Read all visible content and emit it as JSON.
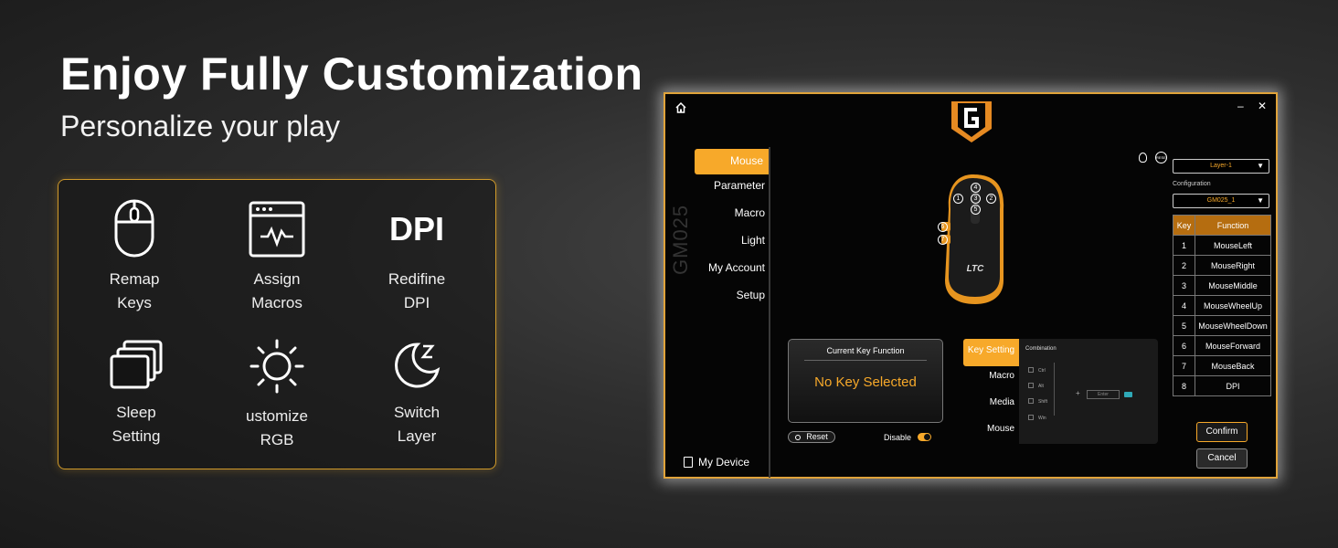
{
  "headline": "Enjoy Fully Customization",
  "subline": "Personalize your play",
  "features": [
    {
      "text": "Remap\nKeys",
      "icon": "mouse-icon"
    },
    {
      "text": "Assign\nMacros",
      "icon": "macro-window-icon"
    },
    {
      "text": "Redifine\nDPI",
      "icon": "dpi-icon",
      "icon_text": "DPI"
    },
    {
      "text": "Sleep\nSetting",
      "icon": "sleep-windows-icon"
    },
    {
      "text": "ustomize\nRGB",
      "icon": "sun-icon"
    },
    {
      "text": "Switch\nLayer",
      "icon": "moon-z-icon"
    }
  ],
  "app": {
    "model": "GM025",
    "nav": [
      "Mouse",
      "Parameter",
      "Macro",
      "Light",
      "My Account",
      "Setup"
    ],
    "my_device": "My Device",
    "layer_select": "Layer-1",
    "configuration_label": "Configuration",
    "configuration_select": "GM025_1",
    "table_headers": [
      "Key",
      "Function"
    ],
    "table_rows": [
      {
        "key": "1",
        "fn": "MouseLeft"
      },
      {
        "key": "2",
        "fn": "MouseRight"
      },
      {
        "key": "3",
        "fn": "MouseMiddle"
      },
      {
        "key": "4",
        "fn": "MouseWheelUp"
      },
      {
        "key": "5",
        "fn": "MouseWheelDown"
      },
      {
        "key": "6",
        "fn": "MouseForward"
      },
      {
        "key": "7",
        "fn": "MouseBack"
      },
      {
        "key": "8",
        "fn": "DPI"
      }
    ],
    "current_key_title": "Current Key Function",
    "current_key_value": "No Key Selected",
    "reset_label": "Reset",
    "disable_label": "Disable",
    "sub_tabs": [
      "Key Setting",
      "Macro",
      "Media",
      "Mouse"
    ],
    "combination_label": "Combination",
    "modifiers": [
      "Ctrl",
      "Alt",
      "Shift",
      "Win"
    ],
    "enter_placeholder": "Enter",
    "confirm_label": "Confirm",
    "cancel_label": "Cancel",
    "mouse_brand": "LTC",
    "button_numbers": [
      "1",
      "2",
      "3",
      "4",
      "5",
      "6",
      "7"
    ],
    "minimize": "–",
    "close": "✕",
    "reset_icon_text": "RESET",
    "accent_color": "#f7a92a"
  }
}
